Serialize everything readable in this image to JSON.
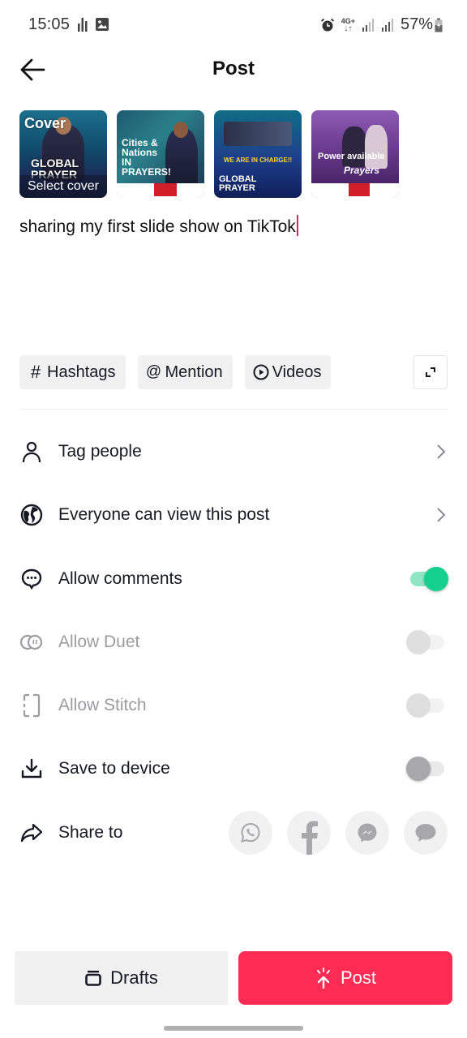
{
  "status_bar": {
    "time": "15:05",
    "network": "4G+",
    "battery": "57%"
  },
  "header": {
    "title": "Post"
  },
  "thumbnails": [
    {
      "overlay_top": "Cover",
      "overlay_bottom": "Select cover",
      "headline": "GLOBAL PRAYER"
    },
    {
      "headline": "Cities & Nations IN PRAYERS!"
    },
    {
      "headline": "WE ARE IN CHARGE!!",
      "sub": "GLOBAL PRAYER"
    },
    {
      "headline": "Power available",
      "sub": "Prayers"
    }
  ],
  "caption": {
    "text": "sharing my first slide show on TikTok"
  },
  "chips": [
    {
      "icon": "hash-icon",
      "glyph": "#",
      "label": "Hashtags"
    },
    {
      "icon": "at-icon",
      "glyph": "@",
      "label": "Mention"
    },
    {
      "icon": "play-circle-icon",
      "glyph": "",
      "label": "Videos"
    }
  ],
  "settings": {
    "tag_people": "Tag people",
    "privacy": "Everyone can view this post",
    "allow_comments": {
      "label": "Allow comments",
      "on": true
    },
    "allow_duet": {
      "label": "Allow Duet",
      "on": false,
      "disabled": true
    },
    "allow_stitch": {
      "label": "Allow Stitch",
      "on": false,
      "disabled": true
    },
    "save_to_device": {
      "label": "Save to device",
      "on": false
    },
    "share_to": {
      "label": "Share to",
      "targets": [
        "WhatsApp",
        "Facebook",
        "Messenger",
        "SMS"
      ]
    }
  },
  "buttons": {
    "drafts": "Drafts",
    "post": "Post"
  },
  "colors": {
    "accent": "#fe2c55",
    "toggle_on": "#14d08e",
    "caret": "#e0245e"
  }
}
